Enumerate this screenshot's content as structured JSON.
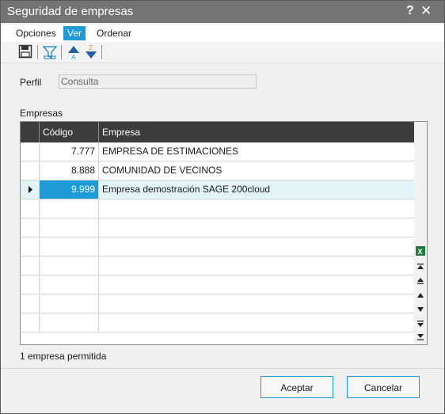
{
  "window": {
    "title": "Seguridad de empresas",
    "help_glyph": "?",
    "close_glyph": "✕"
  },
  "menu": {
    "items": [
      {
        "label": "Opciones"
      },
      {
        "label": "Ver"
      },
      {
        "label": "Ordenar"
      }
    ]
  },
  "toolbar": {
    "icons": [
      "save-icon",
      "filter-icon",
      "sort-ascending-icon",
      "sort-descending-icon"
    ]
  },
  "form": {
    "perfil_label": "Perfil",
    "perfil_value": "Consulta",
    "empresas_label": "Empresas"
  },
  "grid": {
    "columns": [
      "Código",
      "Empresa"
    ],
    "rows": [
      {
        "code": "7.777",
        "name": "EMPRESA DE ESTIMACIONES"
      },
      {
        "code": "8.888",
        "name": "COMUNIDAD DE VECINOS"
      },
      {
        "code": "9.999",
        "name": "Empresa demostración SAGE 200cloud"
      }
    ],
    "selected_row_index": 2,
    "empty_rows": 7,
    "side_icons": [
      "excel-icon",
      "first-page-icon",
      "page-up-icon",
      "row-up-icon",
      "row-down-icon",
      "page-down-icon",
      "last-page-icon"
    ],
    "excel_glyph": "X"
  },
  "status": {
    "text": "1 empresa permitida"
  },
  "buttons": {
    "accept": "Aceptar",
    "cancel": "Cancelar"
  },
  "colors": {
    "accent": "#1e9ad6",
    "titlebar": "#747474",
    "grid_header": "#3c3c3c",
    "selected_row": "#e2f4f8"
  }
}
